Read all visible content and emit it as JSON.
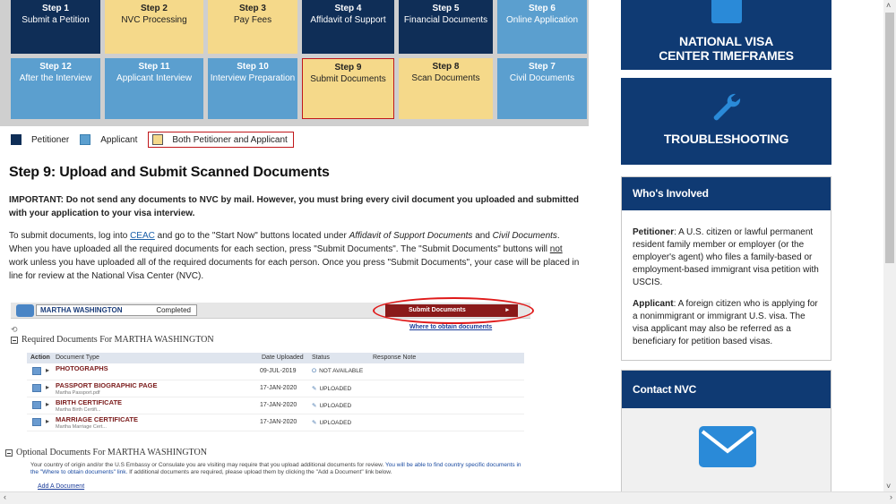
{
  "steps_top": [
    {
      "num": "Step 1",
      "label": "Submit a Petition",
      "color": "dark"
    },
    {
      "num": "Step 2",
      "label": "NVC Processing",
      "color": "yellow"
    },
    {
      "num": "Step 3",
      "label": "Pay Fees",
      "color": "yellow"
    },
    {
      "num": "Step 4",
      "label": "Affidavit of Support",
      "color": "dark"
    },
    {
      "num": "Step 5",
      "label": "Financial Documents",
      "color": "dark"
    },
    {
      "num": "Step 6",
      "label": "Online Application",
      "color": "blue"
    }
  ],
  "steps_bottom": [
    {
      "num": "Step 12",
      "label": "After the Interview",
      "color": "blue"
    },
    {
      "num": "Step 11",
      "label": "Applicant Interview",
      "color": "blue"
    },
    {
      "num": "Step 10",
      "label": "Interview Preparation",
      "color": "blue"
    },
    {
      "num": "Step 9",
      "label": "Submit Documents",
      "color": "yellow",
      "selected": true
    },
    {
      "num": "Step 8",
      "label": "Scan Documents",
      "color": "yellow"
    },
    {
      "num": "Step 7",
      "label": "Civil Documents",
      "color": "blue"
    }
  ],
  "legend": {
    "petitioner": "Petitioner",
    "applicant": "Applicant",
    "both": "Both Petitioner and Applicant"
  },
  "article": {
    "title": "Step 9: Upload and Submit Scanned Documents",
    "important": "IMPORTANT: Do not send any documents to NVC by mail. However, you must bring every civil document you uploaded and submitted with your application to your visa interview.",
    "para_1": "To submit documents, log into ",
    "link_ceac": "CEAC",
    "para_2": " and go to the \"Start Now\" buttons located under ",
    "em_1": "Affidavit of Support Documents",
    "para_3": " and ",
    "em_2": "Civil Documents",
    "para_4": ". When you have uploaded all the required documents for each section, press \"Submit Documents\". The \"Submit Documents\" buttons will ",
    "u_not": "not",
    "para_5": " work unless you have uploaded all of the required documents for each person. Once you press \"Submit Documents\", your case will be placed in line for review at the National Visa Center (NVC)."
  },
  "screenshot": {
    "name": "MARTHA WASHINGTON",
    "status": "Completed",
    "submit": "Submit Documents",
    "where": "Where to obtain documents",
    "required_title": "Required Documents For MARTHA WASHINGTON",
    "headers": [
      "Action",
      "Document Type",
      "Date Uploaded",
      "Status",
      "Response Note"
    ],
    "rows": [
      {
        "doc": "PHOTOGRAPHS",
        "sub": "",
        "date": "09-JUL-2019",
        "status": "NOT AVAILABLE"
      },
      {
        "doc": "PASSPORT BIOGRAPHIC PAGE",
        "sub": "Martha Passport.pdf",
        "date": "17-JAN-2020",
        "status": "UPLOADED"
      },
      {
        "doc": "BIRTH CERTIFICATE",
        "sub": "Martha Birth Certifi...",
        "date": "17-JAN-2020",
        "status": "UPLOADED"
      },
      {
        "doc": "MARRIAGE CERTIFICATE",
        "sub": "Martha Marriage Cert...",
        "date": "17-JAN-2020",
        "status": "UPLOADED"
      }
    ],
    "optional_title": "Optional Documents For MARTHA WASHINGTON",
    "optional_text_1": "Your country of origin and/or the U.S Embassy or Consulate you are visiting may require that you upload additional documents for review. ",
    "optional_text_2": "You will be able to find country specific documents in the \"Where to obtain documents\" link.",
    "optional_text_3": " If additional documents are required, please upload them by clicking the \"Add a Document\" link below.",
    "add_doc": "Add A Document"
  },
  "sidebar": {
    "card1": "NATIONAL VISA CENTER TIMEFRAMES",
    "card2": "TROUBLESHOOTING",
    "who_title": "Who's Involved",
    "petitioner_label": "Petitioner",
    "petitioner_text": ": A U.S. citizen or lawful permanent resident family member or employer (or the employer's agent) who files a family-based or employment-based immigrant visa petition with USCIS.",
    "applicant_label": "Applicant",
    "applicant_text": ": A foreign citizen who is applying for a nonimmigrant or immigrant U.S. visa. The visa applicant may also be referred as a beneficiary for petition based visas.",
    "contact_title": "Contact NVC"
  },
  "colors": {
    "dark": "#0f2e57",
    "blue": "#5b9fcf",
    "yellow": "#f5d98a",
    "accent_red": "#c0171b",
    "sidebar_blue": "#0f3a73"
  }
}
